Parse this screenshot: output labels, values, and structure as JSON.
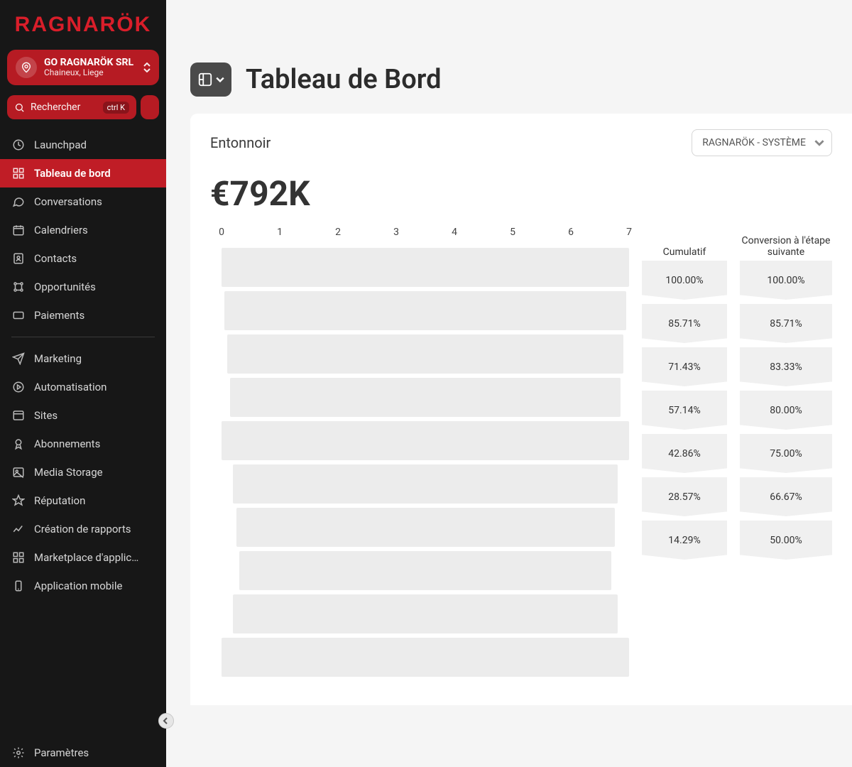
{
  "brand": "RAGNARÖK",
  "org": {
    "name": "GO RAGNARÖK SRL",
    "subtitle": "Chaineux, Liege"
  },
  "search": {
    "placeholder": "Rechercher",
    "shortcut": "ctrl K"
  },
  "nav": {
    "items": [
      {
        "label": "Launchpad"
      },
      {
        "label": "Tableau de bord",
        "active": true
      },
      {
        "label": "Conversations"
      },
      {
        "label": "Calendriers"
      },
      {
        "label": "Contacts"
      },
      {
        "label": "Opportunités"
      },
      {
        "label": "Paiements"
      }
    ],
    "items2": [
      {
        "label": "Marketing"
      },
      {
        "label": "Automatisation"
      },
      {
        "label": "Sites"
      },
      {
        "label": "Abonnements"
      },
      {
        "label": "Media Storage"
      },
      {
        "label": "Réputation"
      },
      {
        "label": "Création de rapports"
      },
      {
        "label": "Marketplace d'applic…"
      },
      {
        "label": "Application mobile"
      }
    ],
    "settings": "Paramètres"
  },
  "page": {
    "title": "Tableau de Bord",
    "card_title": "Entonnoir",
    "pipeline": "RAGNARÖK - SYSTÈME",
    "big_value": "€792K",
    "col_cumulative": "Cumulatif",
    "col_conversion": "Conversion à l'étape suivante"
  },
  "chart_data": {
    "type": "bar",
    "orientation": "horizontal",
    "title": "Entonnoir",
    "xlabel": "",
    "ylabel": "",
    "xlim": [
      0,
      7
    ],
    "x_ticks": [
      0,
      1,
      2,
      3,
      4,
      5,
      6,
      7
    ],
    "bars": [
      {
        "value": 7,
        "cumulative": "100.00%",
        "conversion": "100.00%"
      },
      {
        "value": 6.9,
        "cumulative": "85.71%",
        "conversion": "85.71%"
      },
      {
        "value": 6.8,
        "cumulative": "71.43%",
        "conversion": "83.33%"
      },
      {
        "value": 6.7,
        "cumulative": "57.14%",
        "conversion": "80.00%"
      },
      {
        "value": 7,
        "cumulative": "42.86%",
        "conversion": "75.00%"
      },
      {
        "value": 6.6,
        "cumulative": "28.57%",
        "conversion": "66.67%"
      },
      {
        "value": 6.5,
        "cumulative": "14.29%",
        "conversion": "50.00%"
      },
      {
        "value": 6.4,
        "cumulative": "",
        "conversion": ""
      },
      {
        "value": 6.6,
        "cumulative": "",
        "conversion": ""
      },
      {
        "value": 7,
        "cumulative": "",
        "conversion": ""
      }
    ]
  }
}
